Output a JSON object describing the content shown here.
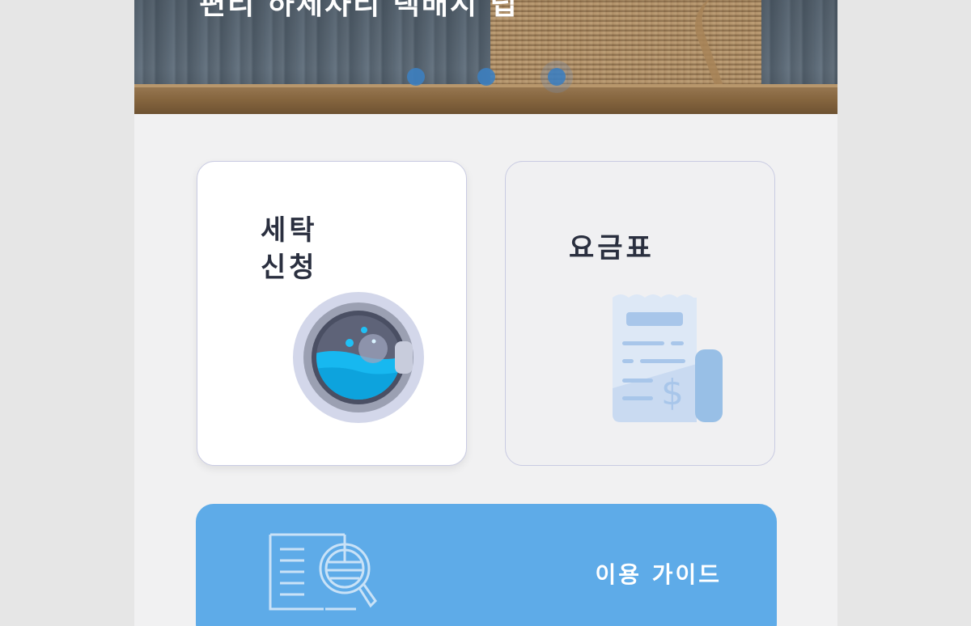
{
  "hero": {
    "headline": "편리 하세차리 택배시 립",
    "carousel_dots": [
      {
        "name": "slide-1",
        "active": false
      },
      {
        "name": "slide-2",
        "active": false
      },
      {
        "name": "slide-3",
        "active": true
      }
    ]
  },
  "cards": {
    "wash": {
      "label": "세탁 신청",
      "icon": "washing-machine-icon"
    },
    "price": {
      "label": "요금표",
      "icon": "receipt-dollar-icon"
    }
  },
  "guide": {
    "label": "이용 가이드",
    "icon": "book-magnifier-icon"
  },
  "colors": {
    "page_bg": "#e6e6e6",
    "content_bg": "#f1f1f2",
    "accent_blue": "#5eabe8",
    "dot_blue": "#3d7fc0",
    "title_text": "#2a2f3f"
  }
}
